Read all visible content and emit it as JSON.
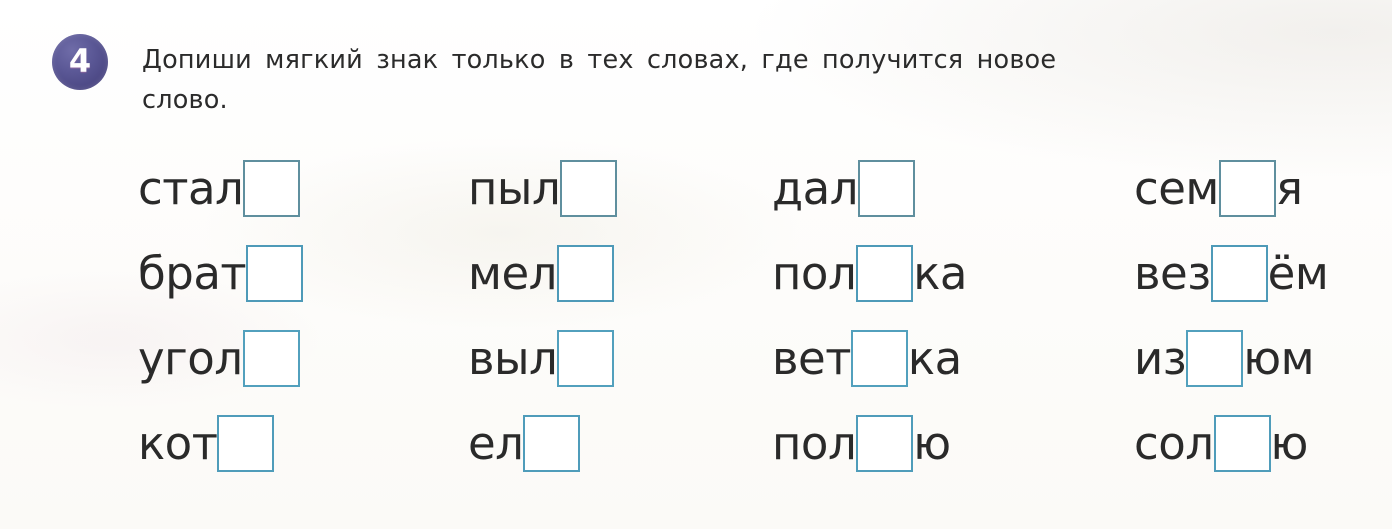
{
  "worksheet": {
    "task_number": "4",
    "badge_color": "#4a4682",
    "blank_box_color": "#4e97b5",
    "text_color": "#2a2a2a",
    "instruction": {
      "line1": "Допиши мягкий знак только в тех словах, где получится новое",
      "line2": "слово."
    },
    "columns": [
      {
        "name": "column-1",
        "rows": [
          {
            "prefix": "стал",
            "suffix": ""
          },
          {
            "prefix": "брат",
            "suffix": ""
          },
          {
            "prefix": "угол",
            "suffix": ""
          },
          {
            "prefix": "кот",
            "suffix": ""
          }
        ]
      },
      {
        "name": "column-2",
        "rows": [
          {
            "prefix": "пыл",
            "suffix": ""
          },
          {
            "prefix": "мел",
            "suffix": ""
          },
          {
            "prefix": "выл",
            "suffix": ""
          },
          {
            "prefix": "ел",
            "suffix": ""
          }
        ]
      },
      {
        "name": "column-3",
        "rows": [
          {
            "prefix": "дал",
            "suffix": ""
          },
          {
            "prefix": "пол",
            "suffix": "ка"
          },
          {
            "prefix": "вет",
            "suffix": "ка"
          },
          {
            "prefix": "пол",
            "suffix": "ю"
          }
        ]
      },
      {
        "name": "column-4",
        "rows": [
          {
            "prefix": "сем",
            "suffix": "я"
          },
          {
            "prefix": "вез",
            "suffix": "ём"
          },
          {
            "prefix": "из",
            "suffix": "юм"
          },
          {
            "prefix": "сол",
            "suffix": "ю"
          }
        ]
      }
    ]
  }
}
